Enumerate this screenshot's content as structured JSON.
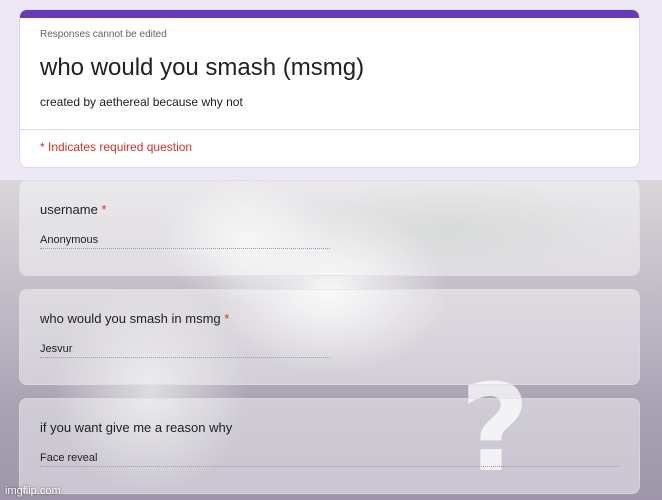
{
  "header": {
    "accent_color": "#673ab7",
    "responses_note": "Responses cannot be edited",
    "title": "who would you smash (msmg)",
    "description": "created by aethereal because why not",
    "required_note": "* Indicates required question"
  },
  "questions": [
    {
      "label": "username",
      "required_mark": "*",
      "answer": "Anonymous"
    },
    {
      "label": "who would you smash in msmg",
      "required_mark": "*",
      "answer": "Jesvur"
    },
    {
      "label": "if you want give me a reason why",
      "required_mark": "",
      "answer": "Face reveal"
    }
  ],
  "background": {
    "question_mark": "?"
  },
  "watermark": "imgflip.com"
}
